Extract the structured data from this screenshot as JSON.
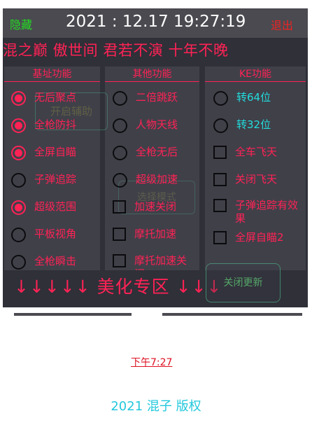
{
  "topbar": {
    "hide_label": "隐藏",
    "clock": "2021 : 12.17 19:27:19",
    "exit_label": "退出"
  },
  "banner": "混之巅 傲世间 君若不演 十年不晚",
  "columns": [
    {
      "title": "基址功能",
      "items": [
        {
          "label": "无后聚点",
          "control": "radio",
          "checked": true
        },
        {
          "label": "全枪防抖",
          "control": "radio",
          "checked": true
        },
        {
          "label": "全屏自瞄",
          "control": "radio",
          "checked": true
        },
        {
          "label": "子弹追踪",
          "control": "radio",
          "checked": false
        },
        {
          "label": "超级范围",
          "control": "radio",
          "checked": true
        },
        {
          "label": "平板视角",
          "control": "radio",
          "checked": false
        },
        {
          "label": "全枪瞬击",
          "control": "radio",
          "checked": false
        }
      ]
    },
    {
      "title": "其他功能",
      "items": [
        {
          "label": "二倍跳跃",
          "control": "radio",
          "checked": false
        },
        {
          "label": "人物天线",
          "control": "radio",
          "checked": false
        },
        {
          "label": "全枪无后",
          "control": "radio",
          "checked": false
        },
        {
          "label": "超级加速",
          "control": "radio",
          "checked": false
        },
        {
          "label": "加速关闭",
          "control": "checkbox",
          "checked": false
        },
        {
          "label": "摩托加速",
          "control": "checkbox",
          "checked": false
        },
        {
          "label": "摩托加速关闭",
          "control": "checkbox",
          "checked": false
        }
      ]
    },
    {
      "title": "KE功能",
      "items": [
        {
          "label": "转64位",
          "control": "radio",
          "checked": false,
          "color": "#22dddd"
        },
        {
          "label": "转32位",
          "control": "radio",
          "checked": false,
          "color": "#22dddd"
        },
        {
          "label": "全车飞天",
          "control": "checkbox",
          "checked": false
        },
        {
          "label": "关闭飞天",
          "control": "checkbox",
          "checked": false
        },
        {
          "label": "子弹追踪有效果",
          "control": "checkbox",
          "checked": false
        },
        {
          "label": "全屏自瞄2",
          "control": "checkbox",
          "checked": false
        }
      ]
    }
  ],
  "overlay_button": "开启辅助",
  "ghost_button": "选择模式",
  "beauty_zone": "↓↓↓↓↓ 美化专区 ↓↓↓",
  "close_update_button": "关闭更新",
  "footer": {
    "time": "下午7:27",
    "copyright": "2021 混子 版权"
  },
  "colors": {
    "accent": "#ff2255",
    "panel": "#2f3038",
    "column": "#404049",
    "cyan": "#22dddd",
    "green": "#22dd22",
    "exit": "#ee2222"
  }
}
